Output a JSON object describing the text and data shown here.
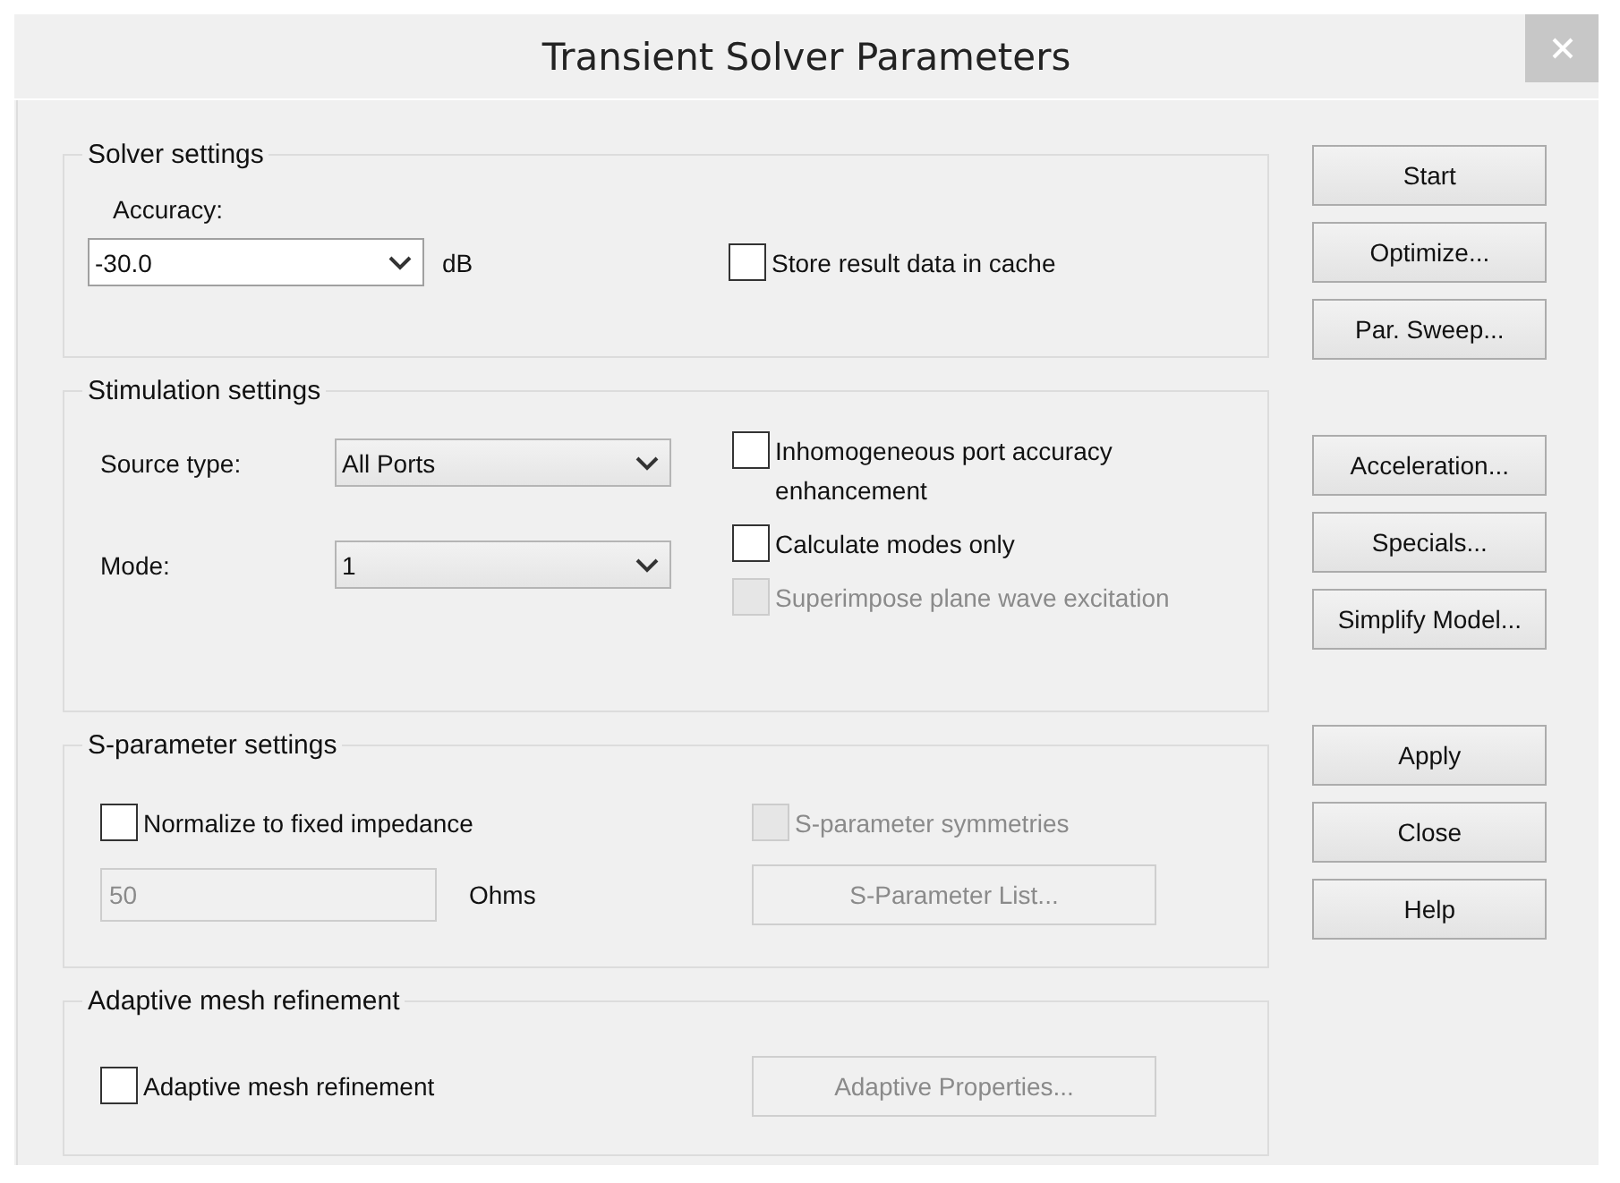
{
  "window": {
    "title": "Transient Solver Parameters"
  },
  "solver_settings": {
    "title": "Solver settings",
    "accuracy_label": "Accuracy:",
    "accuracy": {
      "value": "-30.0",
      "kind": "editable"
    },
    "unit": "dB",
    "store_cache": {
      "label": "Store result data in cache",
      "checked": false,
      "disabled": false
    }
  },
  "stimulation_settings": {
    "title": "Stimulation settings",
    "source_label": "Source type:",
    "source": {
      "value": "All Ports",
      "kind": "list"
    },
    "mode_label": "Mode:",
    "mode": {
      "value": "1",
      "kind": "list"
    },
    "checkboxes": [
      {
        "label": "Inhomogeneous port accuracy enhancement",
        "checked": false,
        "disabled": false
      },
      {
        "label": "Calculate modes only",
        "checked": false,
        "disabled": false
      },
      {
        "label": "Superimpose plane wave excitation",
        "checked": false,
        "disabled": true
      }
    ]
  },
  "s_parameter_settings": {
    "title": "S-parameter settings",
    "normalize": {
      "label": "Normalize to fixed impedance",
      "checked": false,
      "disabled": false
    },
    "symmetries": {
      "label": "S-parameter symmetries",
      "checked": false,
      "disabled": true
    },
    "impedance": {
      "value": "50",
      "disabled": true
    },
    "unit": "Ohms",
    "list_button": {
      "label": "S-Parameter List...",
      "disabled": true
    }
  },
  "adaptive_mesh": {
    "title": "Adaptive mesh refinement",
    "checkbox": {
      "label": "Adaptive mesh refinement",
      "checked": false,
      "disabled": false
    },
    "properties_button": {
      "label": "Adaptive Properties...",
      "disabled": true
    }
  },
  "button_groups": [
    [
      {
        "label": "Start",
        "disabled": false
      },
      {
        "label": "Optimize...",
        "disabled": false
      },
      {
        "label": "Par. Sweep...",
        "disabled": false
      }
    ],
    [
      {
        "label": "Acceleration...",
        "disabled": false
      },
      {
        "label": "Specials...",
        "disabled": false
      },
      {
        "label": "Simplify Model...",
        "disabled": false
      }
    ],
    [
      {
        "label": "Apply",
        "disabled": false
      },
      {
        "label": "Close",
        "disabled": false
      },
      {
        "label": "Help",
        "disabled": false
      }
    ]
  ]
}
